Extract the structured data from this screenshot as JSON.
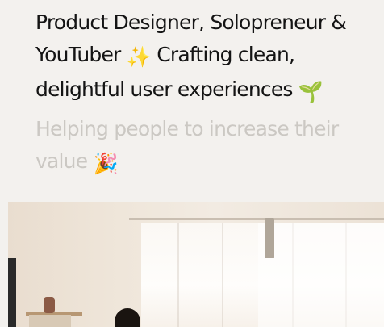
{
  "hero": {
    "headline_text": "Product Designer, Solopreneur & YouTuber",
    "headline_text_2": "Crafting clean, delightful user experiences",
    "sparkles_emoji": "✨",
    "seedling_emoji": "🌱",
    "subline_text": "Helping people to increase their value",
    "party_emoji": "🎉"
  },
  "photo": {
    "description": ""
  }
}
